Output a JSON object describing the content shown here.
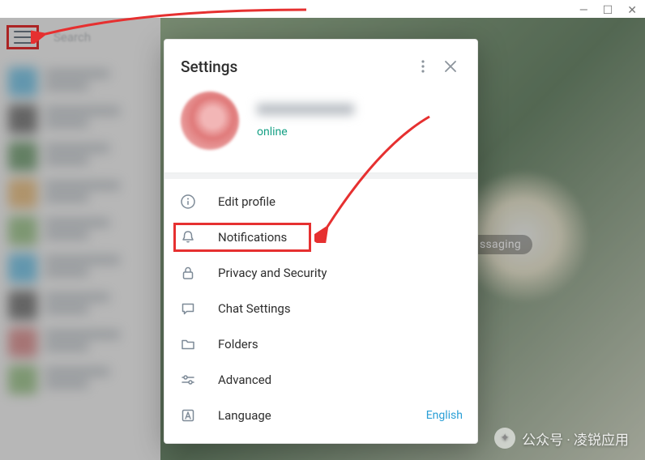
{
  "window_controls": {
    "min": "—",
    "max": "☐",
    "close": "✕"
  },
  "search_placeholder": "Search",
  "bg_badge": "ssaging",
  "settings": {
    "title": "Settings",
    "status": "online",
    "items": [
      {
        "label": "Edit profile",
        "trail": ""
      },
      {
        "label": "Notifications",
        "trail": ""
      },
      {
        "label": "Privacy and Security",
        "trail": ""
      },
      {
        "label": "Chat Settings",
        "trail": ""
      },
      {
        "label": "Folders",
        "trail": ""
      },
      {
        "label": "Advanced",
        "trail": ""
      },
      {
        "label": "Language",
        "trail": "English"
      }
    ]
  },
  "watermark": "公众号 · 凌锐应用"
}
